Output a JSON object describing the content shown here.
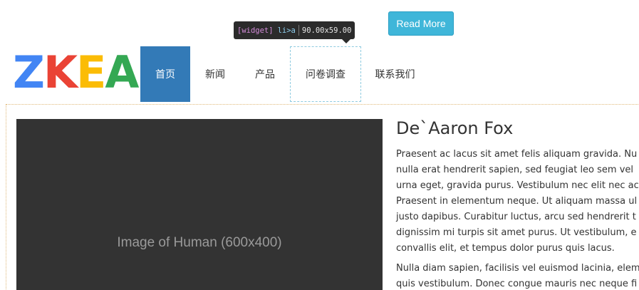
{
  "header": {
    "read_more_label": "Read More",
    "logo": {
      "letters": [
        {
          "char": "Z",
          "color": "#4285f4"
        },
        {
          "char": "K",
          "color": "#ea4335"
        },
        {
          "char": "E",
          "color": "#fbbc05"
        },
        {
          "char": "A",
          "color": "#34a853"
        }
      ]
    },
    "nav": {
      "items": [
        {
          "label": "首页",
          "active": true
        },
        {
          "label": "新闻",
          "active": false
        },
        {
          "label": "产品",
          "active": false
        },
        {
          "label": "问卷调查",
          "active": false
        },
        {
          "label": "联系我们",
          "active": false
        }
      ]
    }
  },
  "inspector_tooltip": {
    "tag": "[widget]",
    "selector": "li>a",
    "dimensions": "90.00x59.00"
  },
  "main": {
    "image_placeholder": "Image of Human (600x400)",
    "article": {
      "title": "De`Aaron Fox",
      "paragraph1_lines": [
        "Praesent ac lacus sit amet felis aliquam gravida. Nu",
        "nulla erat hendrerit sapien, sed feugiat leo sem vel",
        "urna eget, gravida purus. Vestibulum nec elit nec ac",
        "Praesent in elementum neque. Ut aliquam massa ul",
        "justo dapibus. Curabitur luctus, arcu sed hendrerit t",
        "dignissim mi turpis sit amet purus. Ut vestibulum, e",
        "convallis elit, et tempus dolor purus quis lacus."
      ],
      "paragraph2_lines": [
        "Nulla diam sapien, facilisis vel euismod lacinia, elem",
        "quis vestibulum. Donec congue mauris nec neque fi"
      ]
    }
  },
  "colors": {
    "nav_active": "#337ab7",
    "read_more": "#3fb6d9",
    "image_bg": "#333333"
  }
}
